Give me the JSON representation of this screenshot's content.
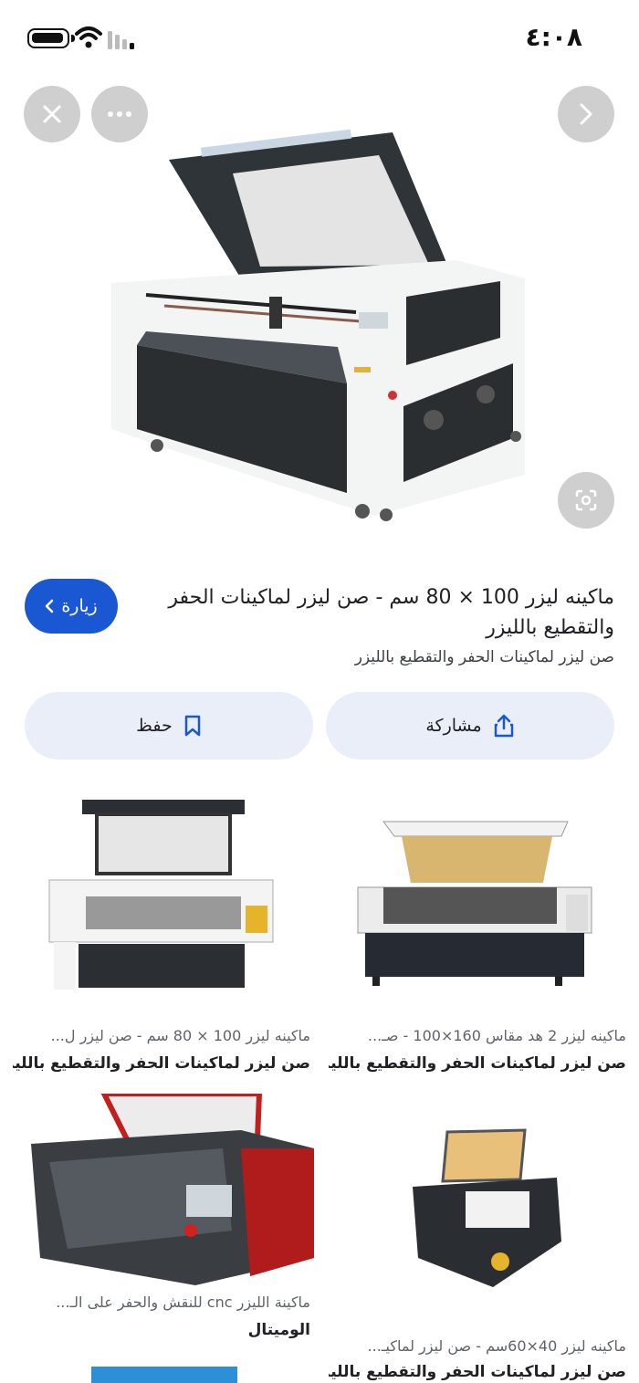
{
  "status": {
    "time": "٤:٠٨"
  },
  "hero": {
    "image_desc": "co2-laser-cutting-machine"
  },
  "result": {
    "title": "ماكينه ليزر 100 × 80 سم - صن ليزر لماكينات الحفر والتقطيع بالليزر",
    "source": "صن ليزر لماكينات الحفر والتقطيع بالليزر",
    "visit_label": "زيارة"
  },
  "actions": {
    "share_label": "مشاركة",
    "save_label": "حفظ"
  },
  "related": [
    {
      "caption": "ماكينه ليزر 2 هد مقاس 160×100 - صـ...",
      "source": "صن ليزر لماكينات الحفر والتقطيع بالليزر"
    },
    {
      "caption": "ماكينه ليزر 100 × 80 سم - صن ليزر ل...",
      "source": "صن ليزر لماكينات الحفر والتقطيع بالليزر"
    },
    {
      "caption": "ماكينه ليزر 40×60سم - صن ليزر لماكيـ...",
      "source": "صن ليزر لماكينات الحفر والتقطيع بالليزر"
    },
    {
      "caption": "ماكينة الليزر cnc للنقش والحفر على الـ...",
      "source": "الوميتال"
    }
  ],
  "colors": {
    "accent": "#1a58d3",
    "pill": "#e9eef8",
    "overlay_btn": "#cfcfcf"
  }
}
